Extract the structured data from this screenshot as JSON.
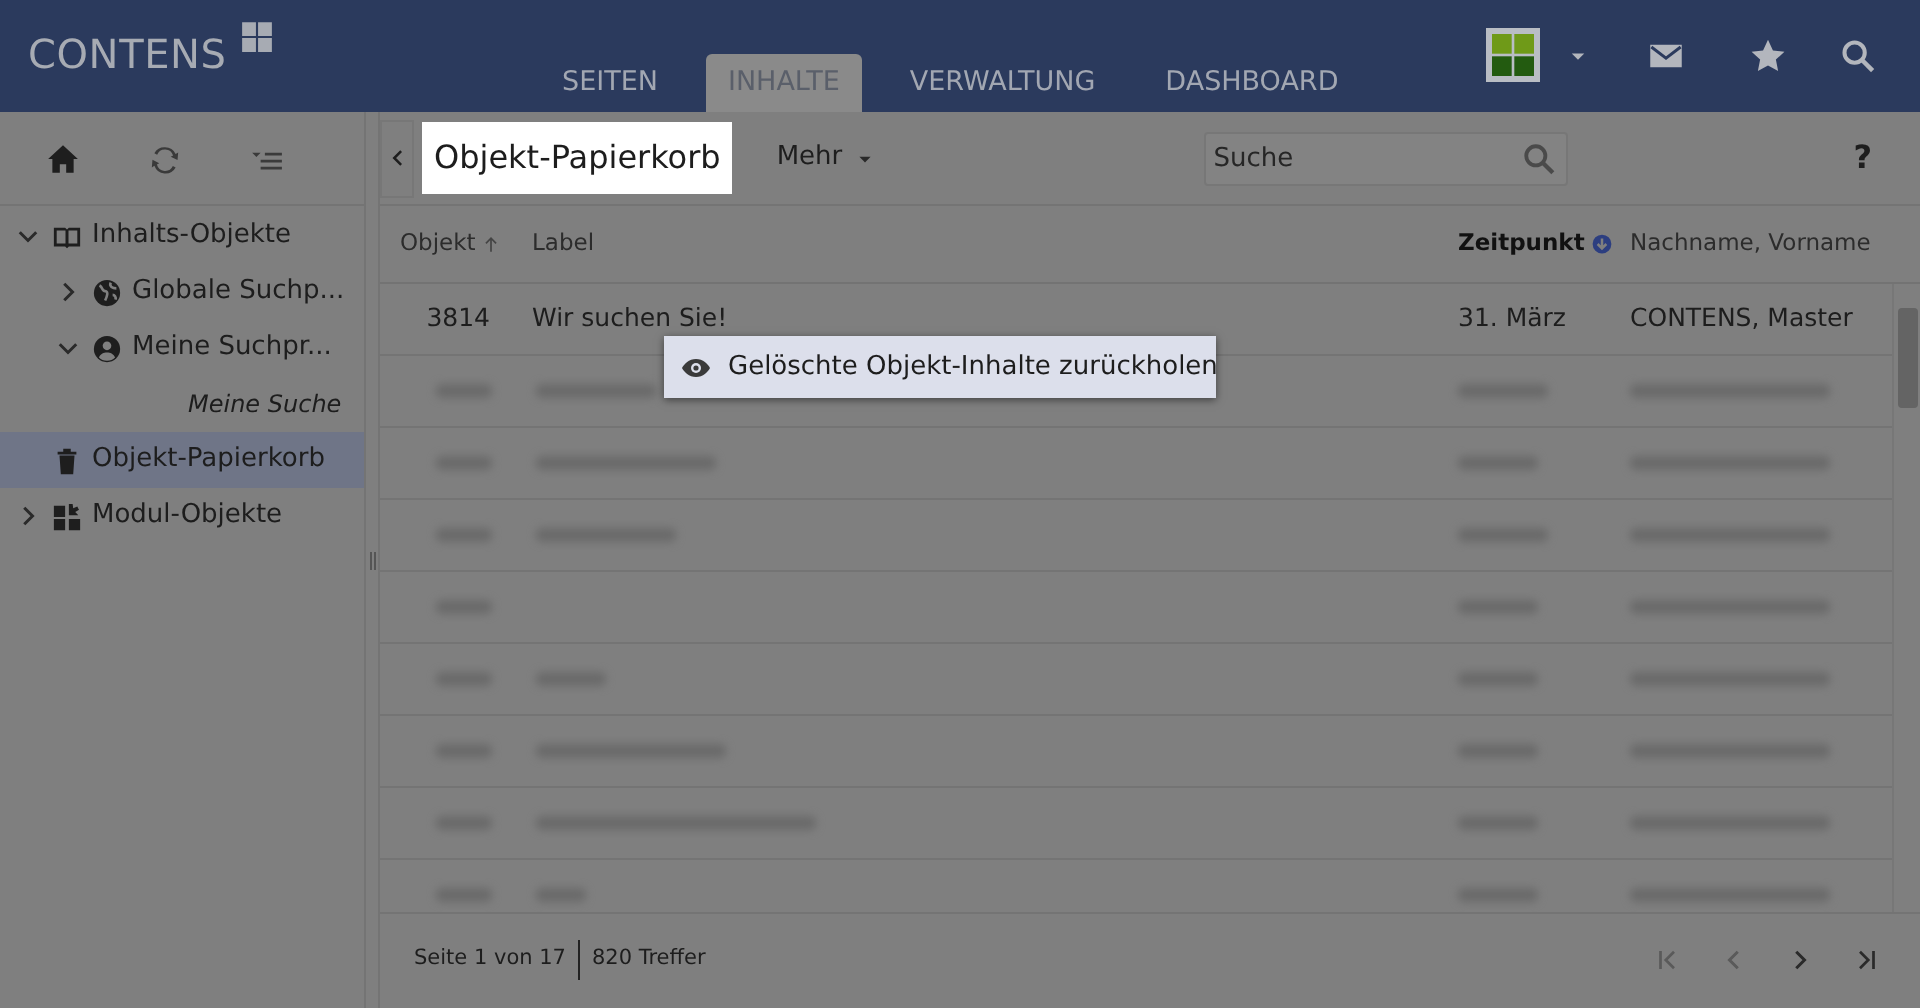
{
  "app": {
    "logo": "CONTENS"
  },
  "nav_tabs": [
    {
      "label": "SEITEN",
      "selected": false
    },
    {
      "label": "INHALTE",
      "selected": true
    },
    {
      "label": "VERWALTUNG",
      "selected": false
    },
    {
      "label": "DASHBOARD",
      "selected": false
    }
  ],
  "sidebar": {
    "items": [
      {
        "label": "Inhalts-Objekte",
        "expanded": true,
        "selected": false,
        "children": [
          {
            "label": "Globale Suchp...",
            "expanded": false,
            "selected": false
          },
          {
            "label": "Meine Suchpr...",
            "expanded": true,
            "selected": false,
            "children": [
              {
                "label": "Meine Suche",
                "kind": "query",
                "selected": false
              }
            ]
          }
        ]
      },
      {
        "label": "Objekt-Papierkorb",
        "selected": true
      },
      {
        "label": "Modul-Objekte",
        "expanded": false,
        "selected": false
      }
    ]
  },
  "toolbar": {
    "title": "Objekt-Papierkorb",
    "menu": "Mehr",
    "search": {
      "placeholder": "Suche"
    },
    "help": "?"
  },
  "table": {
    "columns": [
      {
        "label": "Objekt",
        "sorted": true,
        "descending": false,
        "primary": false
      },
      {
        "label": "Label",
        "sorted": false
      },
      {
        "label": "Zeitpunkt",
        "sorted": true,
        "descending": true,
        "primary": true
      },
      {
        "label": "Nachname, Vorname",
        "sorted": false
      }
    ],
    "rows": [
      {
        "cells": [
          "3814",
          "Wir suchen Sie!",
          "31. März",
          "CONTENS, Master"
        ]
      }
    ]
  },
  "context_menu": {
    "items": [
      {
        "label": "Gelöschte Objekt-Inhalte zurückholen"
      }
    ]
  },
  "status_bar": {
    "page": "Seite 1 von 17",
    "hits": "820 Treffer"
  }
}
